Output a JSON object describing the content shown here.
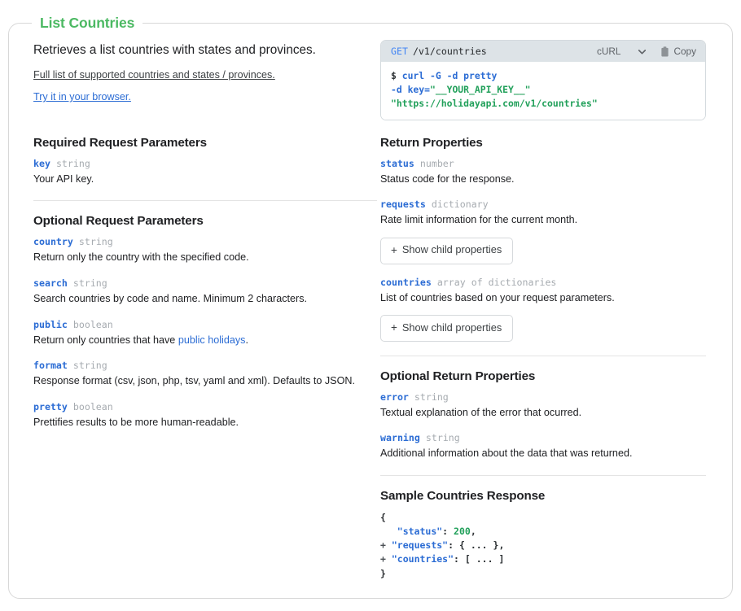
{
  "card": {
    "title": "List Countries"
  },
  "description": {
    "summary": "Retrieves a list countries with states and provinces.",
    "links": [
      {
        "label": "Full list of supported countries and states / provinces.",
        "style": "dark"
      },
      {
        "label": "Try it in your browser.",
        "style": "blue"
      }
    ]
  },
  "code_sample": {
    "method": "GET",
    "path": "/v1/countries",
    "language": "cURL",
    "copy_label": "Copy",
    "chevron_icon": "chevron-down-icon",
    "clipboard_icon": "clipboard-icon",
    "lines": [
      {
        "prompt": "$ ",
        "code": "curl -G -d pretty",
        "color": "blue"
      },
      {
        "prompt": "",
        "code_blue": "-d key=",
        "code_green": "\"__YOUR_API_KEY__\""
      },
      {
        "prompt": "",
        "code": "\"https://holidayapi.com/v1/countries\"",
        "color": "green"
      }
    ]
  },
  "required_request_parameters": {
    "title": "Required Request Parameters",
    "items": [
      {
        "name": "key",
        "type": "string",
        "desc": "Your API key."
      }
    ]
  },
  "optional_request_parameters": {
    "title": "Optional Request Parameters",
    "items": [
      {
        "name": "country",
        "type": "string",
        "desc": "Return only the country with the specified code."
      },
      {
        "name": "search",
        "type": "string",
        "desc": "Search countries by code and name. Minimum 2 characters."
      },
      {
        "name": "public",
        "type": "boolean",
        "desc_before": "Return only countries that have ",
        "link": "public holidays",
        "desc_after": "."
      },
      {
        "name": "format",
        "type": "string",
        "desc": "Response format (csv, json, php, tsv, yaml and xml). Defaults to JSON."
      },
      {
        "name": "pretty",
        "type": "boolean",
        "desc": "Prettifies results to be more human-readable."
      }
    ]
  },
  "return_properties": {
    "title": "Return Properties",
    "items": [
      {
        "name": "status",
        "type": "number",
        "desc": "Status code for the response."
      },
      {
        "name": "requests",
        "type": "dictionary",
        "desc": "Rate limit information for the current month.",
        "child_button": "Show child properties"
      },
      {
        "name": "countries",
        "type": "array of dictionaries",
        "desc": "List of countries based on your request parameters.",
        "child_button": "Show child properties"
      }
    ]
  },
  "optional_return_properties": {
    "title": "Optional Return Properties",
    "items": [
      {
        "name": "error",
        "type": "string",
        "desc": "Textual explanation of the error that ocurred."
      },
      {
        "name": "warning",
        "type": "string",
        "desc": "Additional information about the data that was returned."
      }
    ]
  },
  "sample_response": {
    "title": "Sample Countries Response",
    "open_brace": "{",
    "close_brace": "}",
    "rows": [
      {
        "expander": "",
        "key": "\"status\"",
        "sep": ": ",
        "value": "200",
        "value_type": "number",
        "trail": ","
      },
      {
        "expander": "+",
        "key": "\"requests\"",
        "sep": ": ",
        "value": "{ ... }",
        "value_type": "punct",
        "trail": ","
      },
      {
        "expander": "+",
        "key": "\"countries\"",
        "sep": ": ",
        "value": "[ ... ]",
        "value_type": "punct",
        "trail": ""
      }
    ]
  },
  "colors": {
    "accent_green": "#4cb963",
    "link_blue": "#2b6cd4",
    "type_gray": "#a6abb0",
    "code_header_bg": "#dde3e7",
    "value_green": "#21a05a"
  }
}
